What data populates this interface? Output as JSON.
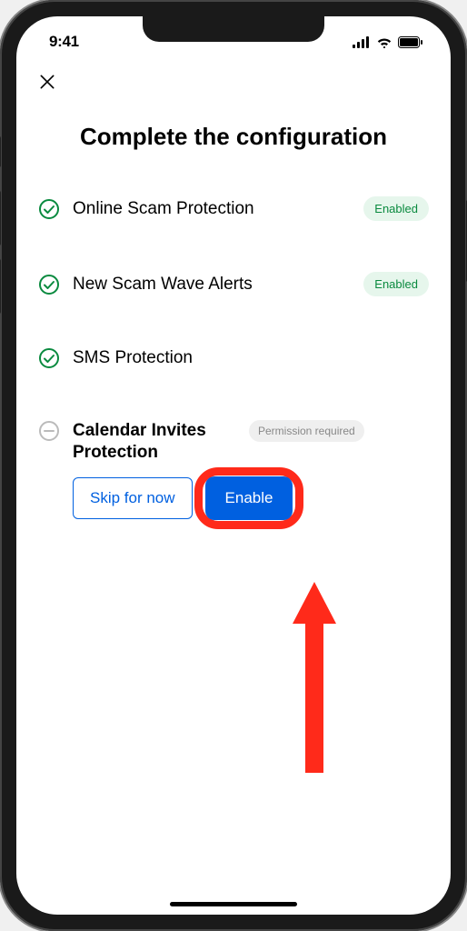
{
  "statusBar": {
    "time": "9:41"
  },
  "title": "Complete the configuration",
  "features": {
    "online": {
      "label": "Online Scam Protection",
      "badge": "Enabled"
    },
    "alerts": {
      "label": "New Scam Wave Alerts",
      "badge": "Enabled"
    },
    "sms": {
      "label": "SMS Protection"
    },
    "calendar": {
      "label": "Calendar Invites Protection",
      "badge": "Permission required"
    }
  },
  "actions": {
    "skip": "Skip for now",
    "enable": "Enable"
  }
}
